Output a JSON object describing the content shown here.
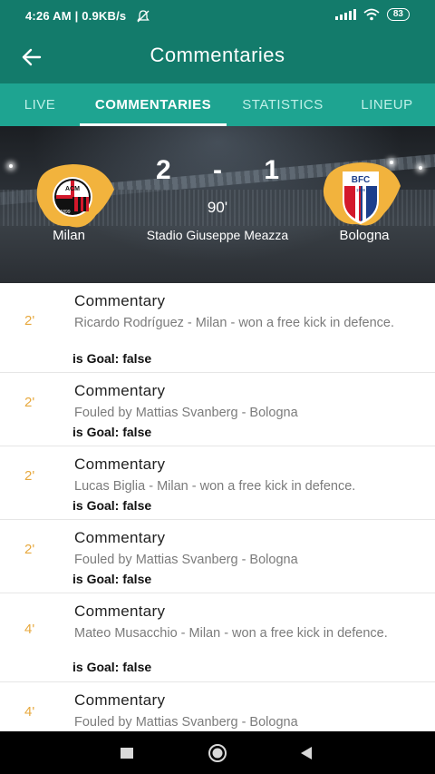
{
  "status": {
    "time": "4:26 AM | 0.9KB/s",
    "battery": "83"
  },
  "appbar": {
    "title": "Commentaries"
  },
  "tabs": [
    {
      "label": "LIVE",
      "active": false
    },
    {
      "label": "COMMENTARIES",
      "active": true
    },
    {
      "label": "STATISTICS",
      "active": false
    },
    {
      "label": "LINEUP",
      "active": false
    }
  ],
  "match": {
    "home_team": "Milan",
    "away_team": "Bologna",
    "home_score": "2",
    "separator": "-",
    "away_score": "1",
    "minute": "90'",
    "stadium": "Stadio Giuseppe Meazza",
    "home_crest_text": "ACM",
    "home_crest_year": "1899",
    "away_crest_text": "BFC",
    "away_crest_year": "1909"
  },
  "commentaries": [
    {
      "minute": "2'",
      "heading": "Commentary",
      "text": "Ricardo Rodríguez  - Milan -  won a free kick in defence.",
      "goal": "is Goal: false"
    },
    {
      "minute": "2'",
      "heading": "Commentary",
      "text": "Fouled by Mattias Svanberg  - Bologna",
      "goal": "is Goal: false"
    },
    {
      "minute": "2'",
      "heading": "Commentary",
      "text": "Lucas Biglia  - Milan -  won a free kick in defence.",
      "goal": "is Goal: false"
    },
    {
      "minute": "2'",
      "heading": "Commentary",
      "text": "Fouled by Mattias Svanberg  - Bologna",
      "goal": "is Goal: false"
    },
    {
      "minute": "4'",
      "heading": "Commentary",
      "text": "Mateo Musacchio  - Milan -  won a free kick in defence.",
      "goal": "is Goal: false"
    },
    {
      "minute": "4'",
      "heading": "Commentary",
      "text": "Fouled by Mattias Svanberg  - Bologna",
      "goal": ""
    }
  ],
  "colors": {
    "primary": "#137b6b",
    "tab_bar": "#1ea491",
    "minute": "#e7a83d",
    "crest_gold": "#f2b33d"
  },
  "icons": {
    "back": "arrow-left-icon",
    "signal": "cell-signal-icon",
    "wifi": "wifi-icon",
    "mute": "bell-off-icon",
    "nav_recents": "square-icon",
    "nav_home": "circle-icon",
    "nav_back": "triangle-back-icon"
  }
}
